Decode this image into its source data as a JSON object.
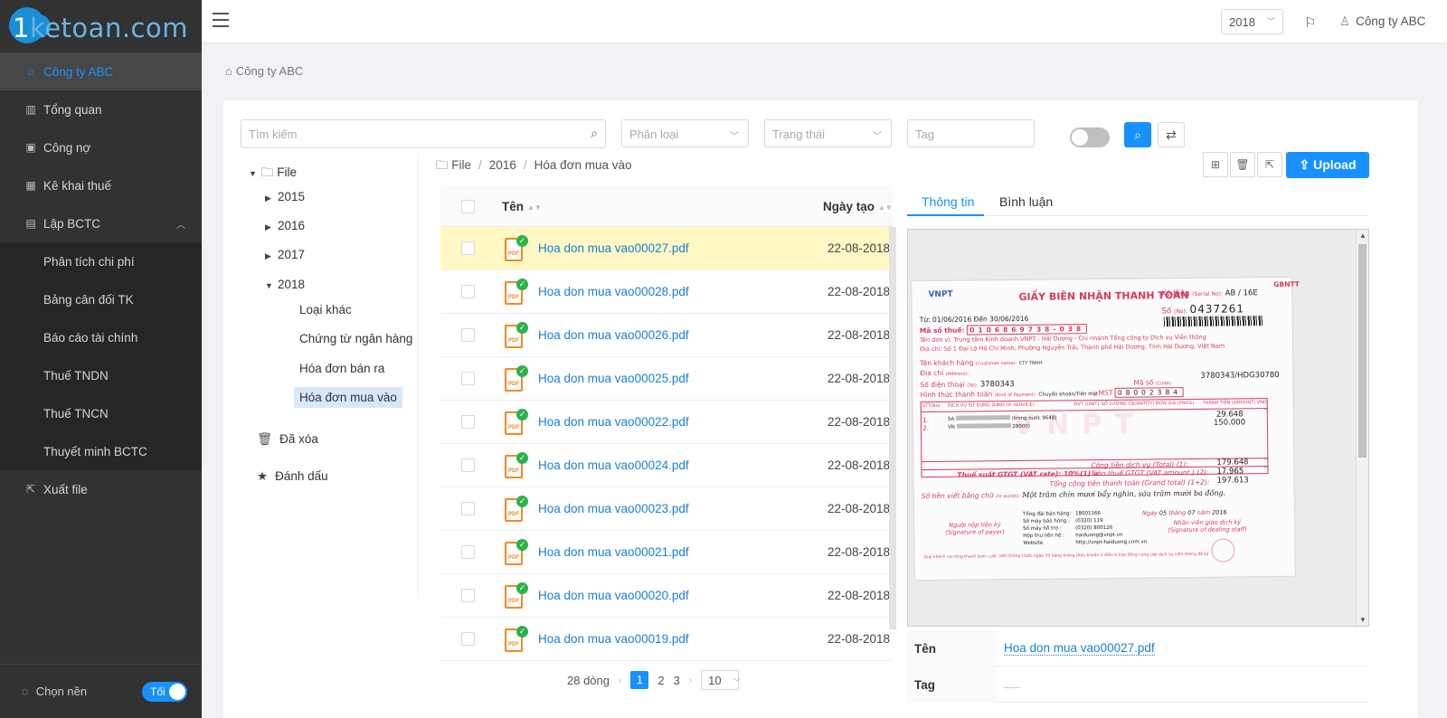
{
  "app": {
    "logo_prefix": "1",
    "logo_main": "ketoan.com"
  },
  "sidebar": {
    "items": [
      {
        "label": "Công ty ABC",
        "icon": "home-icon"
      },
      {
        "label": "Tổng quan",
        "icon": "chart-icon"
      },
      {
        "label": "Công nợ",
        "icon": "ledger-icon"
      },
      {
        "label": "Kê khai thuế",
        "icon": "grid-icon"
      },
      {
        "label": "Lập BCTC",
        "icon": "report-icon"
      }
    ],
    "subitems": [
      {
        "label": "Phân tích chi phí"
      },
      {
        "label": "Bảng cân đối TK"
      },
      {
        "label": "Báo cáo tài chính"
      },
      {
        "label": "Thuế TNDN"
      },
      {
        "label": "Thuế TNCN"
      },
      {
        "label": "Thuyết minh BCTC"
      }
    ],
    "export": {
      "label": "Xuất file",
      "icon": "export-icon"
    },
    "theme": {
      "label": "Chọn nền",
      "toggle": "Tối"
    }
  },
  "topbar": {
    "year": "2018",
    "user": "Công ty ABC"
  },
  "breadcrumb": "Công ty ABC",
  "filters": {
    "search_placeholder": "Tìm kiếm",
    "category_placeholder": "Phân loại",
    "status_placeholder": "Trạng thái",
    "tag_placeholder": "Tag"
  },
  "tree": {
    "root": "File",
    "years": [
      "2015",
      "2016",
      "2017",
      "2018"
    ],
    "children_2018": [
      "Loại khác",
      "Chứng từ ngân hàng",
      "Hóa đơn bán ra",
      "Hóa đơn mua vào"
    ],
    "deleted": "Đã xóa",
    "starred": "Đánh dấu"
  },
  "path": {
    "p1": "File",
    "p2": "2016",
    "p3": "Hóa đơn mua vào"
  },
  "table": {
    "col_name": "Tên",
    "col_date": "Ngày tạo",
    "rows": [
      {
        "name": "Hoa don mua vao00027.pdf",
        "date": "22-08-2018"
      },
      {
        "name": "Hoa don mua vao00028.pdf",
        "date": "22-08-2018"
      },
      {
        "name": "Hoa don mua vao00026.pdf",
        "date": "22-08-2018"
      },
      {
        "name": "Hoa don mua vao00025.pdf",
        "date": "22-08-2018"
      },
      {
        "name": "Hoa don mua vao00022.pdf",
        "date": "22-08-2018"
      },
      {
        "name": "Hoa don mua vao00024.pdf",
        "date": "22-08-2018"
      },
      {
        "name": "Hoa don mua vao00023.pdf",
        "date": "22-08-2018"
      },
      {
        "name": "Hoa don mua vao00021.pdf",
        "date": "22-08-2018"
      },
      {
        "name": "Hoa don mua vao00020.pdf",
        "date": "22-08-2018"
      },
      {
        "name": "Hoa don mua vao00019.pdf",
        "date": "22-08-2018"
      }
    ]
  },
  "pagination": {
    "total": "28 dòng",
    "p1": "1",
    "p2": "2",
    "p3": "3",
    "size": "10"
  },
  "actions": {
    "upload": "Upload"
  },
  "detail": {
    "tab_info": "Thông tin",
    "tab_comment": "Bình luận",
    "name_label": "Tên",
    "name_value": "Hoa don mua vao00027.pdf",
    "tag_label": "Tag",
    "tag_value": "......."
  },
  "invoice": {
    "title": "GIẤY BIÊN NHẬN THANH TOÁN",
    "brand": "VNPT",
    "code": "GBNTT",
    "serial_label": "Ký hiệu",
    "serial_hint": "(Serial No):",
    "serial": "AB / 16E",
    "no_label": "Số",
    "no_hint": "(No):",
    "no": "0437261",
    "period": "Từ: 01/06/2016 Đến 30/06/2016",
    "tax_label": "Mã số thuế:",
    "tax_digits": "0106869738-038",
    "unit": "Tên đơn vị: Trung tâm Kinh doanh VNPT - Hải Dương - Chi nhánh Tổng công ty Dịch vụ Viễn thông",
    "addr": "Địa chỉ: Số 1 Đại Lộ Hồ Chí Minh, Phường Nguyễn Trãi, Thành phố Hải Dương, Tỉnh Hải Dương, Việt Nam",
    "cust_label": "Tên khách hàng",
    "cust_hint": "(Customer name):",
    "cust": "CTY TNHH",
    "addr2_label": "Địa chỉ",
    "addr2_hint": "(Address):",
    "phone_label": "Số điện thoại",
    "phone_hint": "(Tel):",
    "phone": "3780343",
    "acct_label": "Mã số",
    "acct_hint": "(Code):",
    "acct": "3780343/HDG30780",
    "pay_label": "Hình thức thanh toán",
    "pay_hint": "(Kind of Payment):",
    "pay_method": "Chuyển khoản/Tiền mặt",
    "mst_label": "MST",
    "mst_digits": "08002384",
    "cols": [
      "STT(No)",
      "DỊCH VỤ SỬ DỤNG (KIND OF SERVICE)",
      "ĐVT (UNIT)",
      "SỐ LƯỢNG (QUANTITY)",
      "ĐƠN GIÁ (PRICE)",
      "THÀNH TIỀN (AMOUNT) VND"
    ],
    "r1_no": "1.",
    "r2_no": "2.",
    "r1_svc": "SA",
    "r1_svc_end": "(trong nước 9648)",
    "r2_svc": "VN",
    "r2_svc_end": "28000)",
    "r1_amt": "29.648",
    "r2_amt": "150.000",
    "total_label": "Cộng tiền dịch vụ (Total) (1):",
    "total": "179.648",
    "vat_label": "Thuế suất GTGT (VAT rate): 10%(1) =",
    "vat_amt_label": "Tiền thuế GTGT (VAT amount ) (2):",
    "vat": "17.965",
    "grand_label": "Tổng cộng tiền thanh toán (Grand total) (1+2):",
    "grand": "197.613",
    "words_label": "Số tiền viết bằng chữ",
    "words_hint": "(In words):",
    "words": "Một trăm chín mươi bẩy nghìn, sáu trăm mười ba đồng.",
    "hotline_lbl": [
      "Tổng đài bán hàng:",
      "Số máy báo hỏng :",
      "Số máy hỗ trợ :",
      "Hộp thư liên hệ :",
      "Website"
    ],
    "hotline_val": [
      "18001166",
      "(0320) 119",
      "(0320) 800126",
      "haiduong@vnpt.vn",
      "http://vnpt-haiduong.com.vn"
    ],
    "payer_label": "Người nộp tiền ký",
    "payer_hint": "(Signature of payer)",
    "date_label": "Ngày",
    "date_d": "05",
    "date_m_lbl": "tháng",
    "date_m": "07",
    "date_y_lbl": "năm",
    "date_y": "2016",
    "staff_label": "Nhân viên giao dịch ký",
    "staff_hint": "(Signature of dealing staff)",
    "footnote": "Quý khách vui lòng thanh toán cước viễn thông trước ngày 20 hàng tháng theo khoản 2 điều 4 hợp đồng cung cấp dịch vụ viễn thông đã ký"
  },
  "colors": {
    "accent": "#1890ff",
    "sidebar_bg": "#323232",
    "selected_row": "#fff8c4",
    "pdf": "#f08a24",
    "check": "#2bb24c"
  }
}
